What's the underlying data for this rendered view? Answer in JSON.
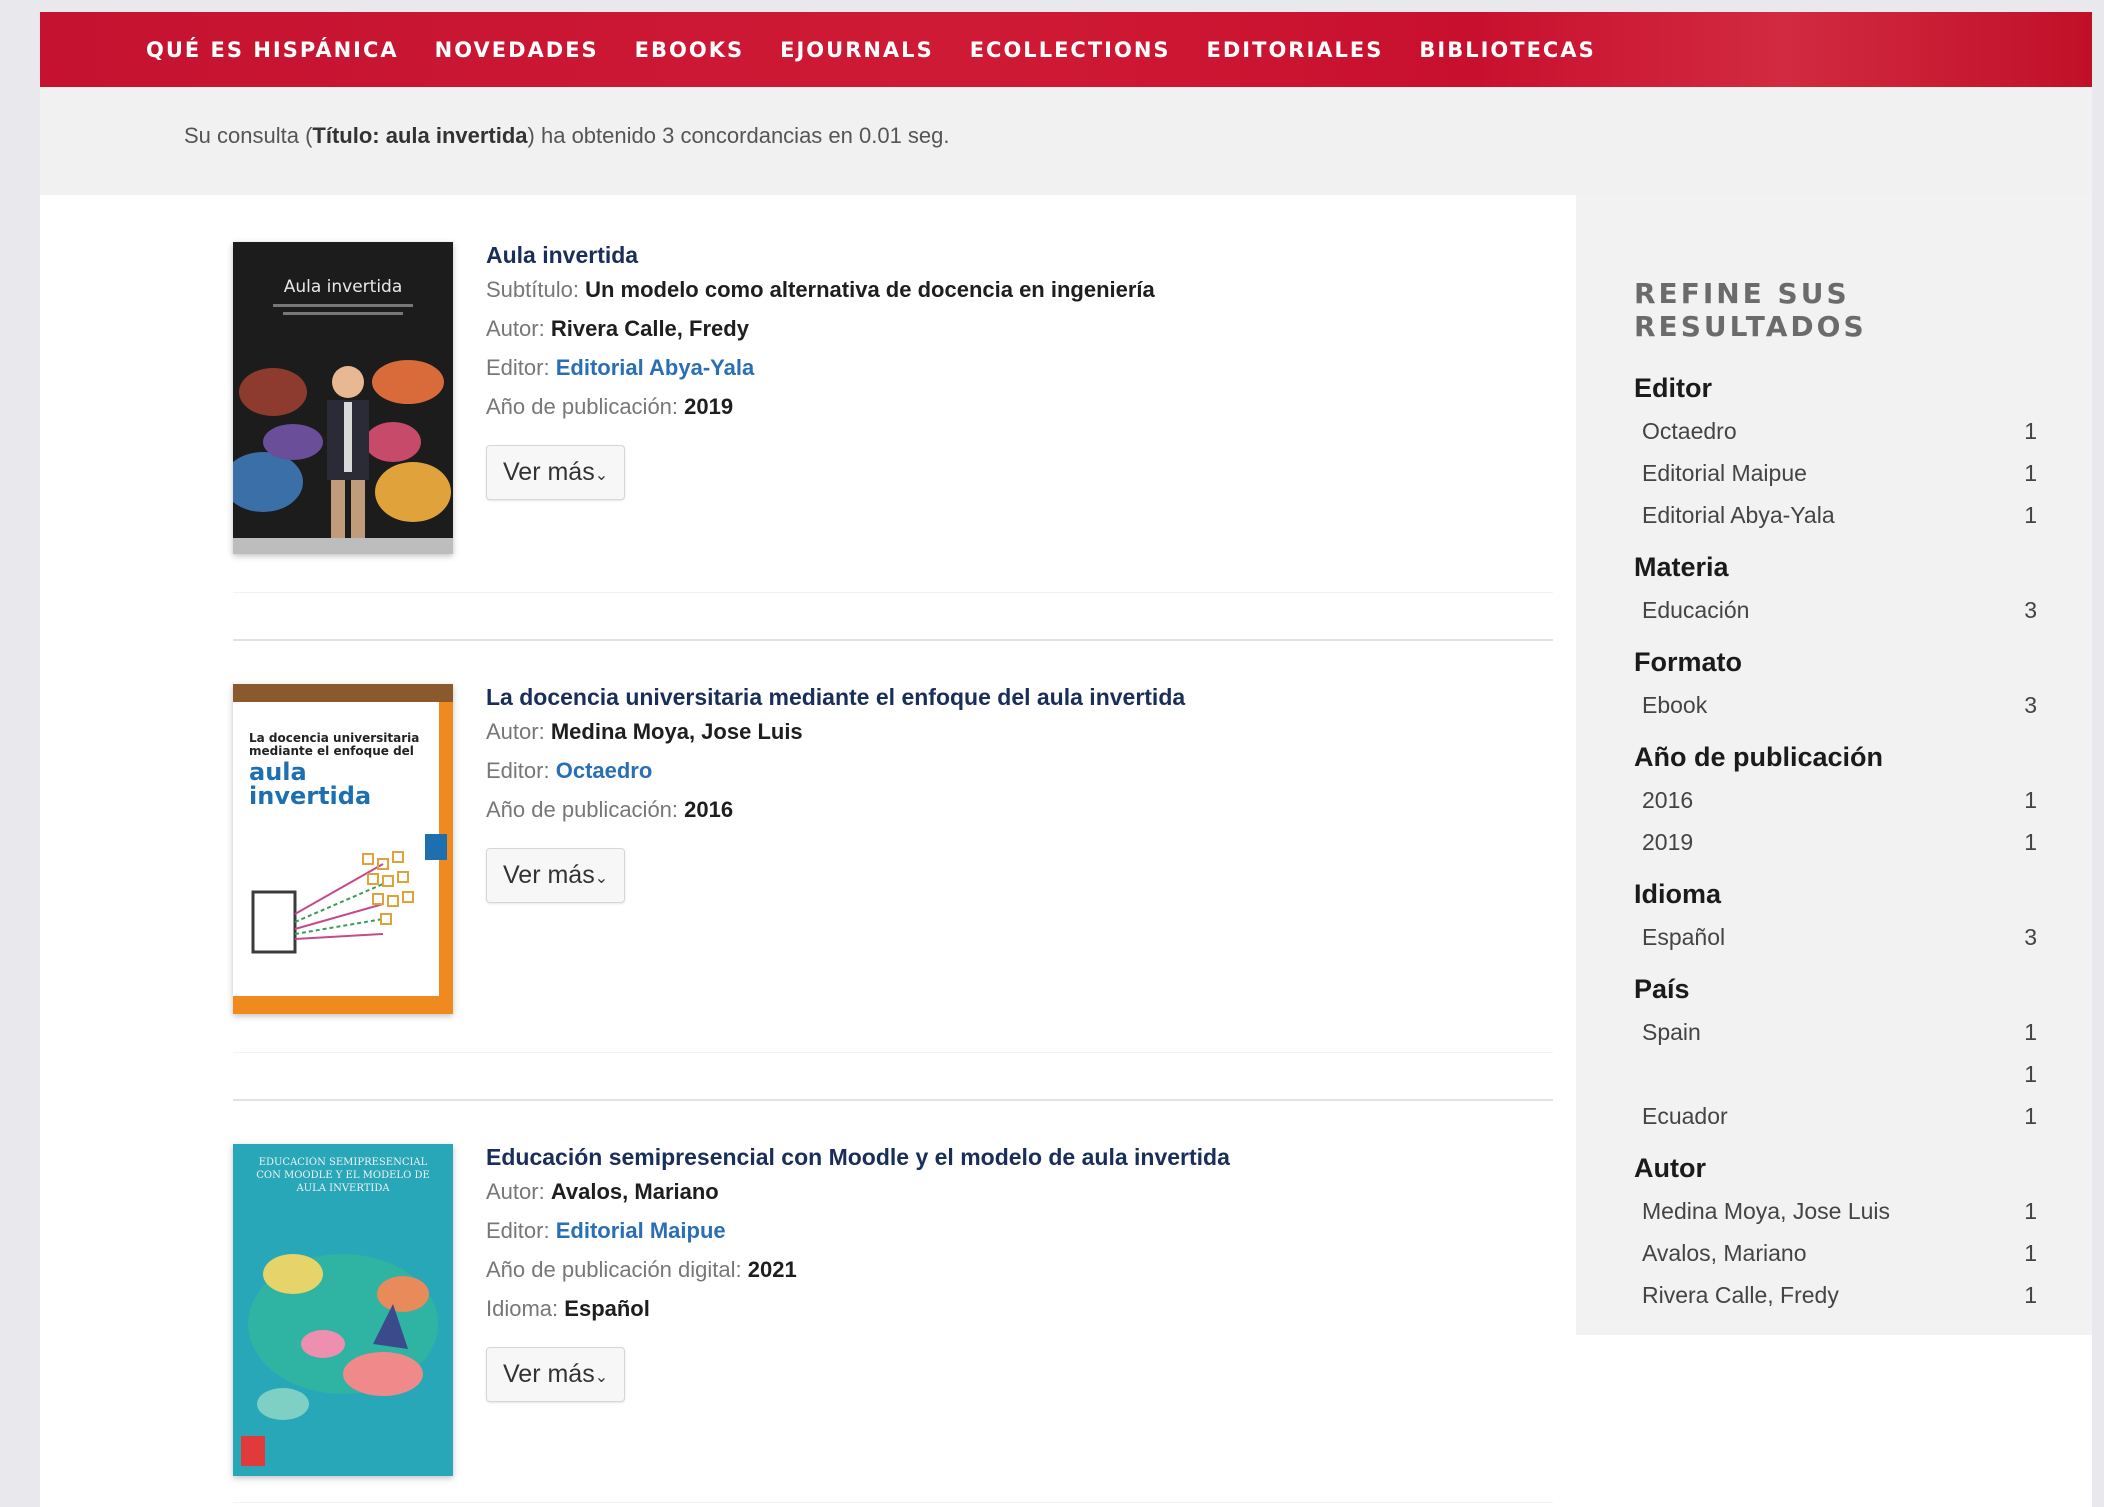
{
  "nav": [
    "QUÉ ES HISPÁNICA",
    "NOVEDADES",
    "EBOOKS",
    "EJOURNALS",
    "ECOLLECTIONS",
    "EDITORIALES",
    "BIBLIOTECAS"
  ],
  "query": {
    "prefix": "Su consulta (",
    "term": "Título: aula invertida",
    "suffix": ") ha obtenido 3 concordancias en 0.01 seg."
  },
  "results": [
    {
      "title": "Aula invertida",
      "subtitle_label": "Subtítulo:",
      "subtitle": "Un modelo como alternativa de docencia en ingeniería",
      "author_label": "Autor:",
      "author": "Rivera Calle, Fredy",
      "editor_label": "Editor:",
      "editor": "Editorial Abya-Yala",
      "year_label": "Año de publicación:",
      "year": "2019",
      "button": "Ver más",
      "cover_text": "Aula invertida"
    },
    {
      "title": "La docencia universitaria mediante el enfoque del aula invertida",
      "author_label": "Autor:",
      "author": "Medina Moya, Jose Luis",
      "editor_label": "Editor:",
      "editor": "Octaedro",
      "year_label": "Año de publicación:",
      "year": "2016",
      "button": "Ver más",
      "cover_line1": "La docencia universitaria mediante el enfoque del",
      "cover_line2": "aula invertida"
    },
    {
      "title": "Educación semipresencial con Moodle y el modelo de aula invertida",
      "author_label": "Autor:",
      "author": "Avalos, Mariano",
      "editor_label": "Editor:",
      "editor": "Editorial Maipue",
      "year_label": "Año de publicación digital:",
      "year": "2021",
      "lang_label": "Idioma:",
      "lang": "Español",
      "button": "Ver más",
      "cover_text": "EDUCACIÓN SEMIPRESENCIAL CON MOODLE Y EL MODELO DE AULA INVERTIDA"
    }
  ],
  "sidebar": {
    "heading": "REFINE SUS RESULTADOS",
    "facets": [
      {
        "title": "Editor",
        "items": [
          [
            "Octaedro",
            "1"
          ],
          [
            "Editorial Maipue",
            "1"
          ],
          [
            "Editorial Abya-Yala",
            "1"
          ]
        ]
      },
      {
        "title": "Materia",
        "items": [
          [
            "Educación",
            "3"
          ]
        ]
      },
      {
        "title": "Formato",
        "items": [
          [
            "Ebook",
            "3"
          ]
        ]
      },
      {
        "title": "Año de publicación",
        "items": [
          [
            "2016",
            "1"
          ],
          [
            "2019",
            "1"
          ]
        ]
      },
      {
        "title": "Idioma",
        "items": [
          [
            "Español",
            "3"
          ]
        ]
      },
      {
        "title": "País",
        "items": [
          [
            "Spain",
            "1"
          ],
          [
            "",
            "1"
          ],
          [
            "Ecuador",
            "1"
          ]
        ]
      },
      {
        "title": "Autor",
        "items": [
          [
            "Medina Moya, Jose Luis",
            "1"
          ],
          [
            "Avalos, Mariano",
            "1"
          ],
          [
            "Rivera Calle, Fredy",
            "1"
          ]
        ]
      }
    ]
  },
  "colors": {
    "nav_red": "#c8102e",
    "link_blue": "#2a6fb5",
    "title_navy": "#1a2e5a"
  }
}
